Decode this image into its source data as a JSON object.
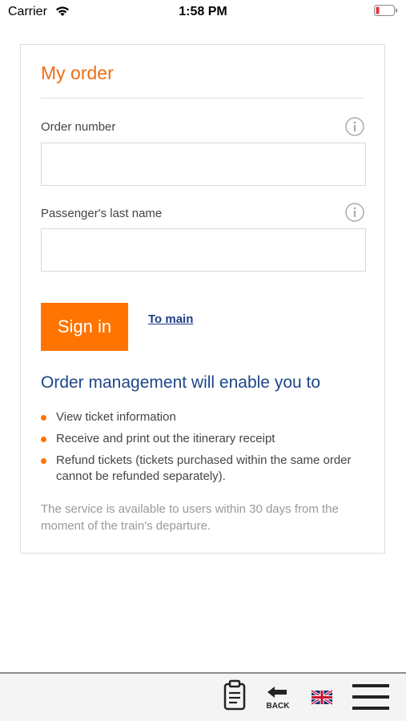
{
  "status_bar": {
    "carrier": "Carrier",
    "time": "1:58 PM"
  },
  "card": {
    "title": "My order",
    "order_number_label": "Order number",
    "order_number_value": "",
    "last_name_label": "Passenger's last name",
    "last_name_value": "",
    "signin_label": "Sign in",
    "to_main_label": "To main",
    "section_heading": "Order management will enable you to",
    "benefits": [
      "View ticket information",
      "Receive and print out the itinerary receipt",
      "Refund tickets (tickets purchased within the same order cannot be refunded separately)."
    ],
    "note": "The service is available to users within 30 days from the moment of the train's departure."
  },
  "toolbar": {
    "back_label": "BACK",
    "icons": [
      "orders-clipboard-icon",
      "back-arrow-icon",
      "uk-flag-icon",
      "hamburger-menu-icon"
    ]
  },
  "colors": {
    "accent_orange": "#ff7400",
    "title_orange": "#f06d14",
    "heading_blue": "#1f4688",
    "link_blue": "#1f3e86",
    "battery_red": "#e23b3b"
  }
}
